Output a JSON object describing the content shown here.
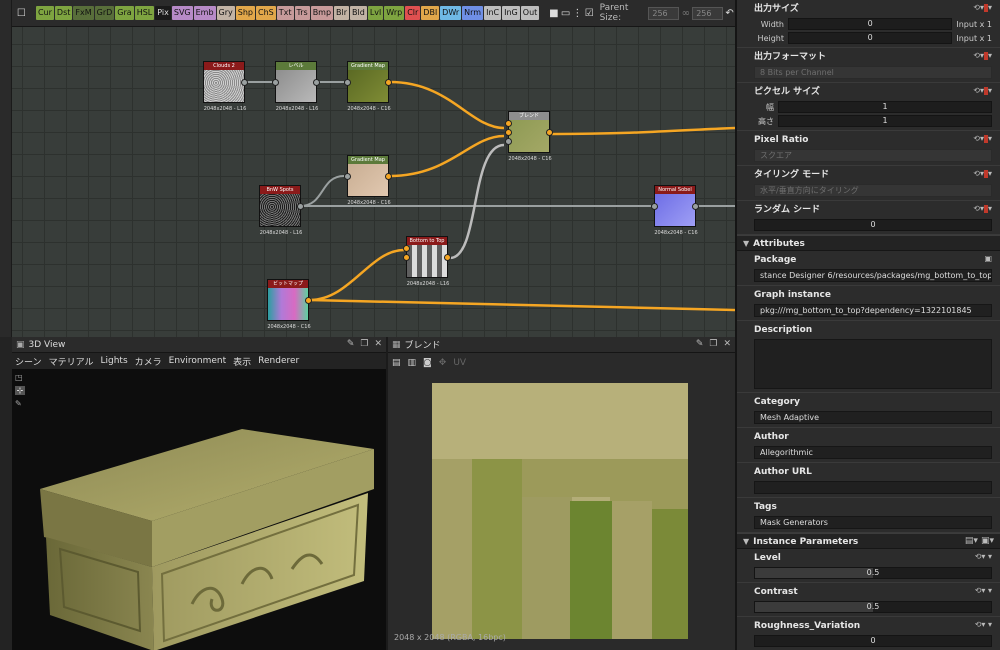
{
  "graph_toolbar": {
    "buttons": [
      {
        "label": "Cur",
        "color": "#7ea440"
      },
      {
        "label": "Dst",
        "color": "#7ea440"
      },
      {
        "label": "FxM",
        "color": "#586e3a"
      },
      {
        "label": "GrD",
        "color": "#586e3a"
      },
      {
        "label": "Gra",
        "color": "#7ea440"
      },
      {
        "label": "HSL",
        "color": "#7ea440"
      },
      {
        "label": "Pix",
        "color": "#1a1a1a"
      },
      {
        "label": "SVG",
        "color": "#b78ac7"
      },
      {
        "label": "Emb",
        "color": "#b78ac7"
      },
      {
        "label": "Gry",
        "color": "#c2b3a5"
      },
      {
        "label": "Shp",
        "color": "#e2a74a"
      },
      {
        "label": "ChS",
        "color": "#e2a74a"
      },
      {
        "label": "Txt",
        "color": "#c79a9a"
      },
      {
        "label": "Trs",
        "color": "#c79a9a"
      },
      {
        "label": "Bmp",
        "color": "#c79a9a"
      },
      {
        "label": "Blr",
        "color": "#c2b3a5"
      },
      {
        "label": "Bld",
        "color": "#c2b3a5"
      },
      {
        "label": "Lvl",
        "color": "#7ea440"
      },
      {
        "label": "Wrp",
        "color": "#7ea440"
      },
      {
        "label": "Clr",
        "color": "#e05050"
      },
      {
        "label": "DBl",
        "color": "#e2a74a"
      },
      {
        "label": "DWr",
        "color": "#6fb9e6"
      },
      {
        "label": "Nrm",
        "color": "#6f8fe6"
      },
      {
        "label": "InC",
        "color": "#bdbdbd"
      },
      {
        "label": "InG",
        "color": "#bdbdbd"
      },
      {
        "label": "Out",
        "color": "#bdbdbd"
      }
    ],
    "parent_size_label": "Parent Size:",
    "parent_w": "256",
    "parent_h": "256"
  },
  "nodes": [
    {
      "id": "clouds",
      "title": "Clouds 2",
      "caption": "2048x2048 - L16",
      "header": "#8b1a1a",
      "fill": "#8a8a8a",
      "fill2": "#cfcfcf"
    },
    {
      "id": "levels",
      "title": "レベル",
      "caption": "2048x2048 - L16",
      "header": "#5c7a3a",
      "fill": "#8e8e8e",
      "fill2": "#b9b9b9"
    },
    {
      "id": "gmap1",
      "title": "Gradient Map",
      "caption": "2048x2048 - C16",
      "header": "#5c7a3a",
      "fill": "#5b6a24",
      "fill2": "#7f8c35"
    },
    {
      "id": "blend",
      "title": "ブレンド",
      "caption": "2048x2048 - C16",
      "header": "#8e8e8e",
      "fill": "#8e9a54",
      "fill2": "#a4a866"
    },
    {
      "id": "gmap2",
      "title": "Gradient Map",
      "caption": "2048x2048 - C16",
      "header": "#5c7a3a",
      "fill": "#c9ae93",
      "fill2": "#e1c8b0"
    },
    {
      "id": "bnw",
      "title": "BnW Spots",
      "caption": "2048x2048 - L16",
      "header": "#8b1a1a",
      "fill": "#1d1d1d",
      "fill2": "#777777"
    },
    {
      "id": "nrm",
      "title": "Normal Sobel",
      "caption": "2048x2048 - C16",
      "header": "#8b1a1a",
      "fill": "#6e6ee6",
      "fill2": "#9f9ff5"
    },
    {
      "id": "b2t",
      "title": "Bottom to Top",
      "caption": "2048x2048 - L16",
      "header": "#8b1a1a",
      "fill": "#5e5e5e",
      "fill2": "#dcdcdc"
    },
    {
      "id": "bitmap",
      "title": "ビットマップ",
      "caption": "2048x2048 - C16",
      "header": "#8b1a1a",
      "fill": "#2b9fa0",
      "fill2": "#d86bc2"
    }
  ],
  "view3d": {
    "title": "3D View",
    "menu": [
      "シーン",
      "マテリアル",
      "Lights",
      "カメラ",
      "Environment",
      "表示",
      "Renderer"
    ]
  },
  "view2d": {
    "title": "ブレンド",
    "uv_label": "UV",
    "status": "2048 x 2048 (RGBA, 16bpc)"
  },
  "props": {
    "output_size": {
      "title": "出力サイズ",
      "width_label": "Width",
      "width_value": "0",
      "height_label": "Height",
      "height_value": "0",
      "suffix": "Input x 1"
    },
    "output_format": {
      "title": "出力フォーマット",
      "value": "8 Bits per Channel"
    },
    "pixel_size": {
      "title": "ピクセル サイズ",
      "width_label": "幅",
      "height_label": "高さ",
      "width_value": "1",
      "height_value": "1"
    },
    "pixel_ratio": {
      "title": "Pixel Ratio",
      "value": "スクエア"
    },
    "tiling": {
      "title": "タイリング モード",
      "value": "水平/垂直方向にタイリング"
    },
    "random_seed": {
      "title": "ランダム シード",
      "value": "0"
    },
    "attributes_header": "Attributes",
    "package": {
      "title": "Package",
      "value": "stance Designer 6/resources/packages/mg_bottom_to_top.sbs"
    },
    "graph_instance": {
      "title": "Graph instance",
      "value": "pkg:///mg_bottom_to_top?dependency=1322101845"
    },
    "description": {
      "title": "Description",
      "value": ""
    },
    "category": {
      "title": "Category",
      "value": "Mesh Adaptive"
    },
    "author": {
      "title": "Author",
      "value": "Allegorithmic"
    },
    "author_url": {
      "title": "Author URL",
      "value": ""
    },
    "tags": {
      "title": "Tags",
      "value": "Mask Generators"
    },
    "instance_header": "Instance Parameters",
    "level": {
      "title": "Level",
      "value": "0.5",
      "fraction": 0.5
    },
    "contrast": {
      "title": "Contrast",
      "value": "0.5",
      "fraction": 0.5
    },
    "roughness": {
      "title": "Roughness_Variation",
      "value": "0",
      "fraction": 0
    }
  }
}
